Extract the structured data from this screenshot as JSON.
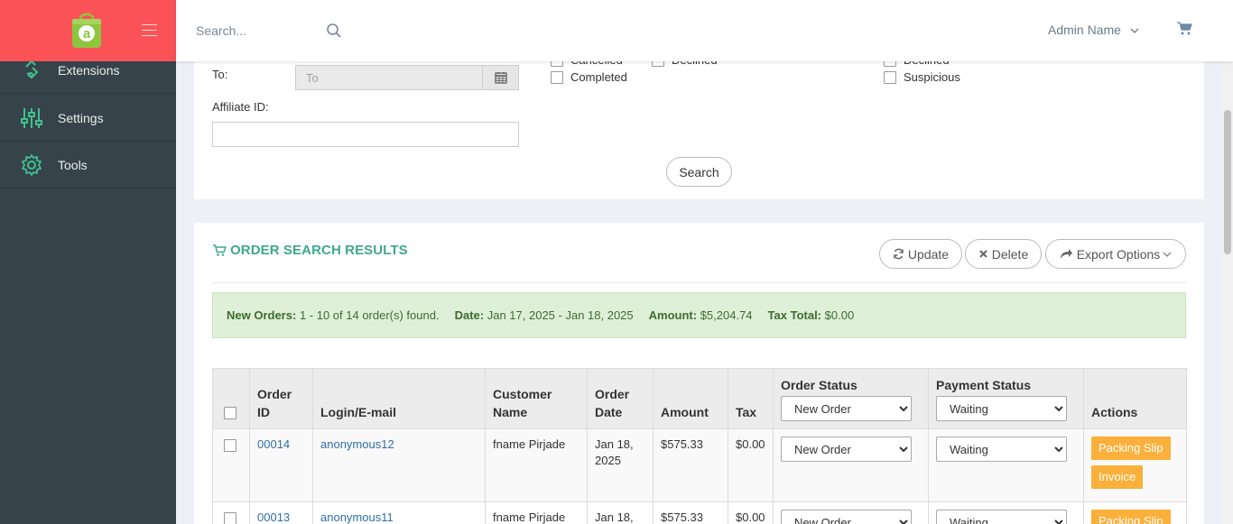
{
  "brand": {
    "logo_letter": "a"
  },
  "sidebar": {
    "items": [
      {
        "label": "Extensions",
        "icon": "extensions-icon"
      },
      {
        "label": "Settings",
        "icon": "sliders-icon"
      },
      {
        "label": "Tools",
        "icon": "gear-icon"
      }
    ]
  },
  "topbar": {
    "search_placeholder": "Search...",
    "admin_name": "Admin Name"
  },
  "filters": {
    "to_label": "To:",
    "to_placeholder": "To",
    "affiliate_label": "Affiliate ID:",
    "order_status_checks": [
      {
        "label": "Cancelled"
      },
      {
        "label": "Declined"
      },
      {
        "label": "Completed"
      }
    ],
    "payment_status_checks": [
      {
        "label": "Declined"
      },
      {
        "label": "Suspicious"
      }
    ],
    "search_button": "Search"
  },
  "results": {
    "title": "ORDER SEARCH RESULTS",
    "update_label": "Update",
    "delete_label": "Delete",
    "export_label": "Export Options",
    "summary": {
      "new_orders_label": "New Orders:",
      "new_orders_value": "1 - 10 of 14 order(s) found.",
      "date_label": "Date:",
      "date_value": "Jan 17, 2025 - Jan 18, 2025",
      "amount_label": "Amount:",
      "amount_value": "$5,204.74",
      "tax_label": "Tax Total:",
      "tax_value": "$0.00"
    },
    "columns": {
      "order_id": "Order ID",
      "login": "Login/E-mail",
      "customer": "Customer Name",
      "date": "Order Date",
      "amount": "Amount",
      "tax": "Tax",
      "order_status": "Order Status",
      "payment_status": "Payment Status",
      "actions": "Actions"
    },
    "header_order_status_value": "New Order",
    "header_payment_status_value": "Waiting",
    "rows": [
      {
        "order_id": "00014",
        "login": "anonymous12",
        "customer": "fname Pirjade",
        "date": "Jan 18, 2025",
        "amount": "$575.33",
        "tax": "$0.00",
        "order_status": "New Order",
        "payment_status": "Waiting",
        "packing_slip": "Packing Slip",
        "invoice": "Invoice"
      },
      {
        "order_id": "00013",
        "login": "anonymous11",
        "customer": "fname Pirjade",
        "date": "Jan 18,",
        "amount": "$575.33",
        "tax": "$0.00",
        "order_status": "New Order",
        "payment_status": "Waiting",
        "packing_slip": "Packing Slip"
      }
    ]
  },
  "colors": {
    "brand_red": "#fb5257",
    "sidebar_bg": "#36434b",
    "accent_green": "#3fa98b",
    "link_blue": "#2f6fa9",
    "action_orange": "#fbb03b",
    "summary_bg": "#dff0d8"
  }
}
